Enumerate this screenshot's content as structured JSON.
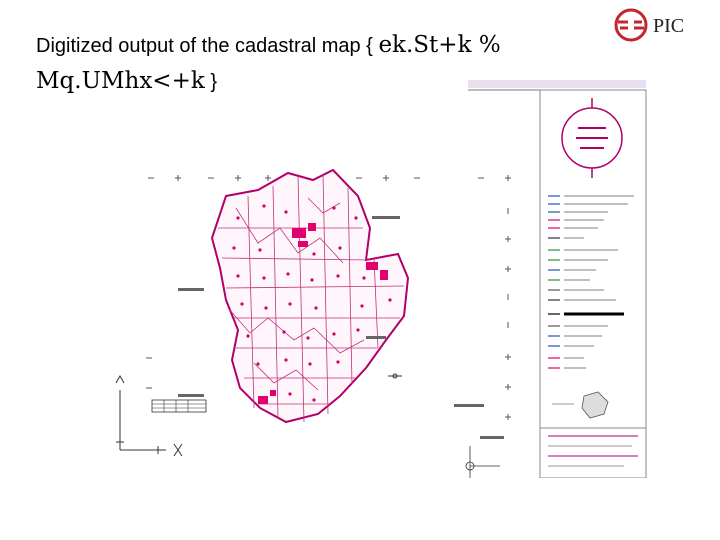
{
  "slide": {
    "title_latin": "Digitized output  of the  cadastral map {",
    "title_serif": "ek.St+k % Mq.UMhx<+k",
    "title_end": "}"
  },
  "logo": {
    "text": "PIC",
    "icon": "pic-emblem-icon",
    "color": "#c1272d"
  },
  "map": {
    "boundary_color": "#b0006a",
    "fill_color": "#ffffff",
    "accent_color": "#e0006f",
    "label_color": "#333333"
  }
}
